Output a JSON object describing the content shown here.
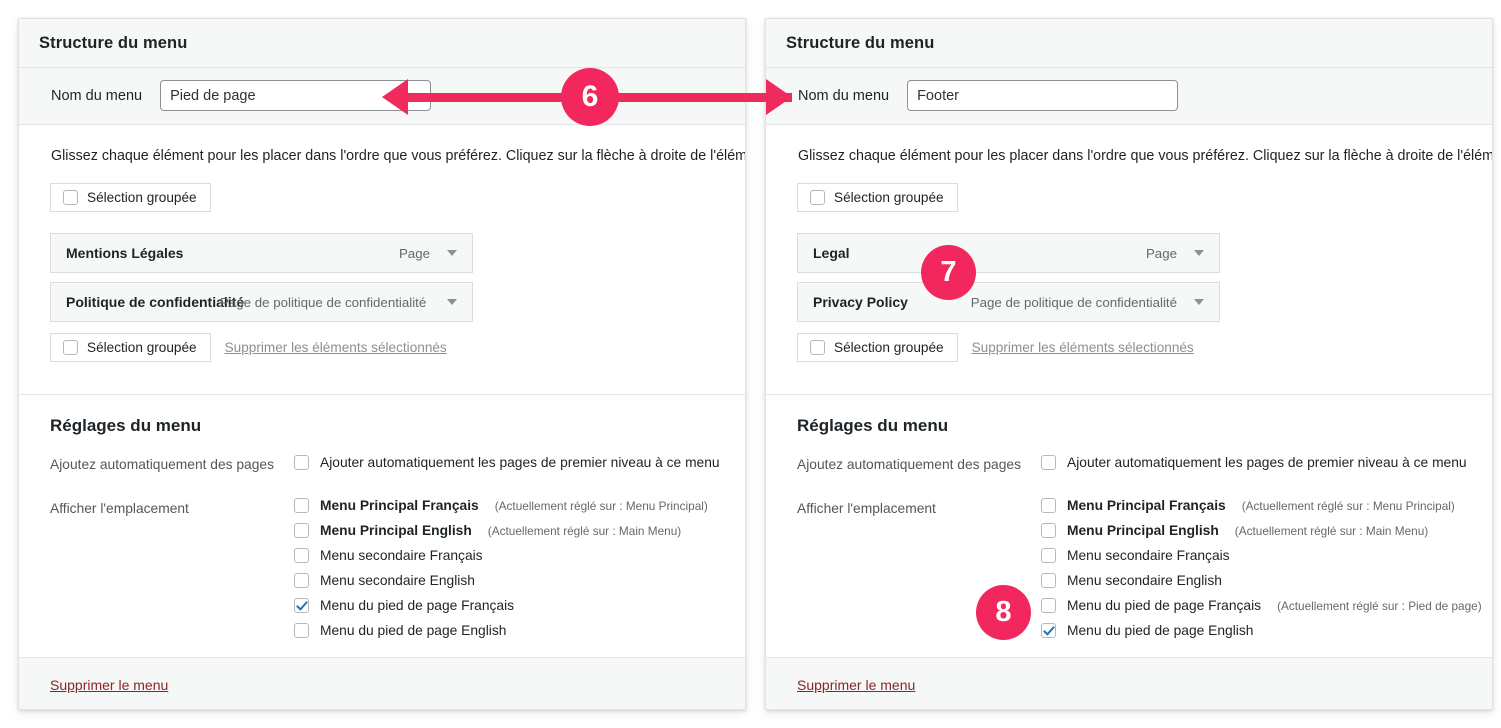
{
  "panels": [
    {
      "header_title": "Structure du menu",
      "name_label": "Nom du menu",
      "name_value": "Pied de page",
      "instruction": "Glissez chaque élément pour les placer dans l'ordre que vous préférez. Cliquez sur la flèche à droite de l'élément.",
      "bulk_select_label": "Sélection groupée",
      "items": [
        {
          "name": "Mentions Légales",
          "type": "Page",
          "overlap": false
        },
        {
          "name": "Politique de confidentialité",
          "type": "Page de politique de confidentialité",
          "overlap": true
        }
      ],
      "bulk_select_bottom_label": "Sélection groupée",
      "delete_selected_label": "Supprimer les éléments sélectionnés",
      "settings_title": "Réglages du menu",
      "auto_add_label": "Ajoutez automatiquement des pages",
      "auto_add_option": "Ajouter automatiquement les pages de premier niveau à ce menu",
      "auto_add_checked": false,
      "locations_label": "Afficher l'emplacement",
      "locations": [
        {
          "label": "Menu Principal Français",
          "hint": "(Actuellement réglé sur : Menu Principal)",
          "checked": false
        },
        {
          "label": "Menu Principal English",
          "hint": "(Actuellement réglé sur : Main Menu)",
          "checked": false
        },
        {
          "label": "Menu secondaire Français",
          "hint": "",
          "checked": false
        },
        {
          "label": "Menu secondaire English",
          "hint": "",
          "checked": false
        },
        {
          "label": "Menu du pied de page Français",
          "hint": "",
          "checked": true
        },
        {
          "label": "Menu du pied de page English",
          "hint": "",
          "checked": false
        }
      ],
      "footer_link": "Supprimer le menu"
    },
    {
      "header_title": "Structure du menu",
      "name_label": "Nom du menu",
      "name_value": "Footer",
      "instruction": "Glissez chaque élément pour les placer dans l'ordre que vous préférez. Cliquez sur la flèche à droite de l'élément.",
      "bulk_select_label": "Sélection groupée",
      "items": [
        {
          "name": "Legal",
          "type": "Page",
          "overlap": false
        },
        {
          "name": "Privacy Policy",
          "type": "Page de politique de confidentialité",
          "overlap": false
        }
      ],
      "bulk_select_bottom_label": "Sélection groupée",
      "delete_selected_label": "Supprimer les éléments sélectionnés",
      "settings_title": "Réglages du menu",
      "auto_add_label": "Ajoutez automatiquement des pages",
      "auto_add_option": "Ajouter automatiquement les pages de premier niveau à ce menu",
      "auto_add_checked": false,
      "locations_label": "Afficher l'emplacement",
      "locations": [
        {
          "label": "Menu Principal Français",
          "hint": "(Actuellement réglé sur : Menu Principal)",
          "checked": false
        },
        {
          "label": "Menu Principal English",
          "hint": "(Actuellement réglé sur : Main Menu)",
          "checked": false
        },
        {
          "label": "Menu secondaire Français",
          "hint": "",
          "checked": false
        },
        {
          "label": "Menu secondaire English",
          "hint": "",
          "checked": false
        },
        {
          "label": "Menu du pied de page Français",
          "hint": "(Actuellement réglé sur : Pied de page)",
          "checked": false
        },
        {
          "label": "Menu du pied de page English",
          "hint": "",
          "checked": true
        }
      ],
      "footer_link": "Supprimer le menu"
    }
  ],
  "annotations": {
    "accent_color": "#f2275e",
    "badges": [
      {
        "number": "6"
      },
      {
        "number": "7"
      },
      {
        "number": "8"
      }
    ]
  }
}
